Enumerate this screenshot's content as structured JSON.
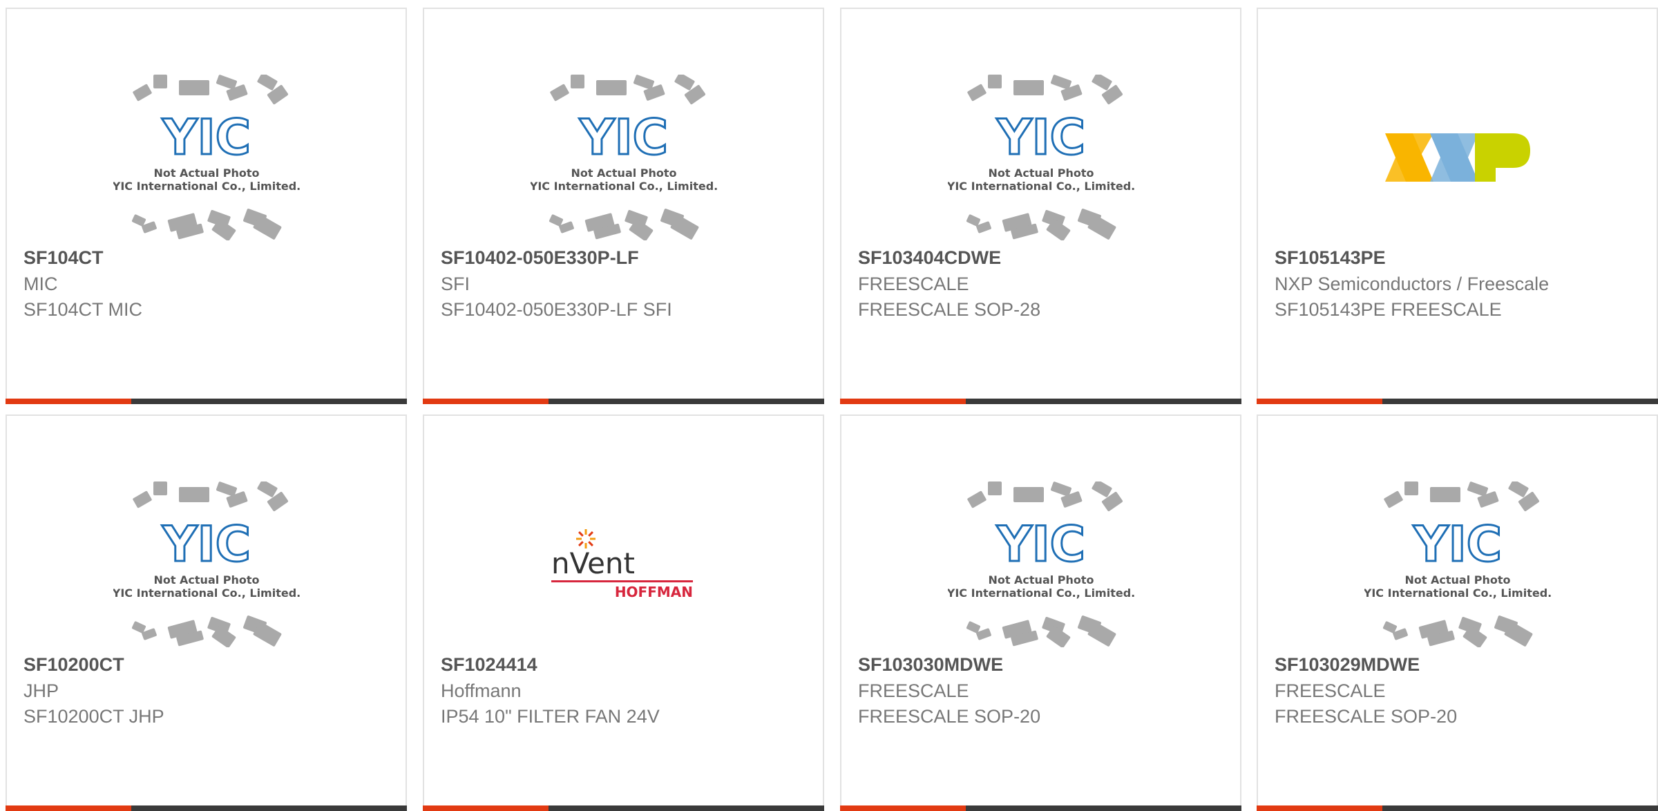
{
  "placeholder": {
    "line1": "Not Actual Photo",
    "line2": "YIC International Co., Limited.",
    "logo": "YIC"
  },
  "logos": {
    "nxp": "NXP",
    "nvent_main": "nVent",
    "nvent_sub": "HOFFMAN"
  },
  "products": [
    {
      "part": "SF104CT",
      "manufacturer": "MIC",
      "description": "SF104CT MIC",
      "image": "yic-placeholder"
    },
    {
      "part": "SF10402-050E330P-LF",
      "manufacturer": "SFI",
      "description": "SF10402-050E330P-LF SFI",
      "image": "yic-placeholder"
    },
    {
      "part": "SF103404CDWE",
      "manufacturer": "FREESCALE",
      "description": "FREESCALE SOP-28",
      "image": "yic-placeholder"
    },
    {
      "part": "SF105143PE",
      "manufacturer": "NXP Semiconductors / Freescale",
      "description": "SF105143PE FREESCALE",
      "image": "nxp-logo"
    },
    {
      "part": "SF10200CT",
      "manufacturer": "JHP",
      "description": "SF10200CT JHP",
      "image": "yic-placeholder"
    },
    {
      "part": "SF1024414",
      "manufacturer": "Hoffmann",
      "description": "IP54 10\" FILTER FAN 24V",
      "image": "nvent-hoffman-logo"
    },
    {
      "part": "SF103030MDWE",
      "manufacturer": "FREESCALE",
      "description": "FREESCALE SOP-20",
      "image": "yic-placeholder"
    },
    {
      "part": "SF103029MDWE",
      "manufacturer": "FREESCALE",
      "description": "FREESCALE SOP-20",
      "image": "yic-placeholder"
    }
  ],
  "colors": {
    "accent": "#e23a12",
    "bar": "#3a3a3a",
    "yic_blue": "#1f6fb5",
    "chip_gray": "#a9a9a9"
  }
}
